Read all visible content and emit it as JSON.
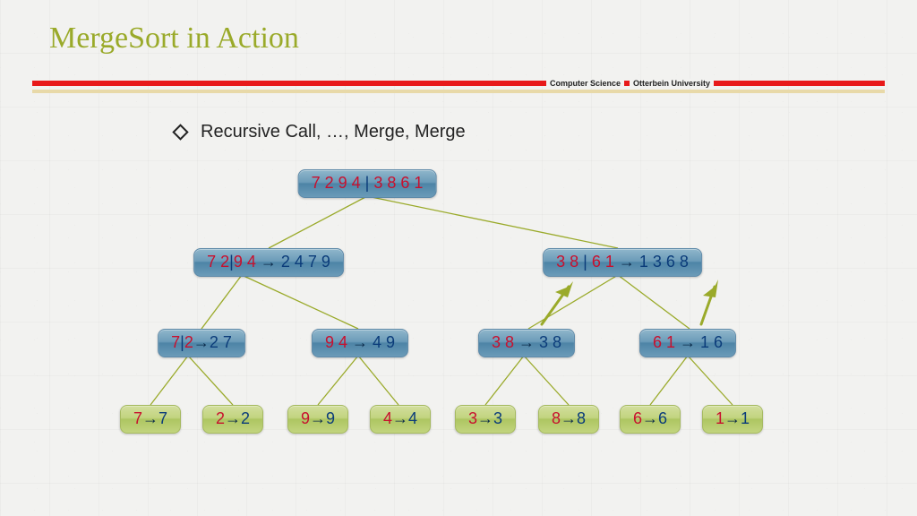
{
  "title": "MergeSort in Action",
  "footer": {
    "dept": "Computer Science",
    "uni": "Otterbein University"
  },
  "bullet": "Recursive Call, …, Merge, Merge",
  "nodes": {
    "root": {
      "left": "7 2 9 4",
      "sep": " | ",
      "right": "3 8 6 1"
    },
    "l2a": {
      "in_l": "7 2",
      "sep1": "|",
      "in_r": "9 4",
      "arrow": " → ",
      "out": "2 4 7 9"
    },
    "l2b": {
      "in_l": "3 8",
      "sep1": " | ",
      "in_r": "6 1",
      "arrow": " → ",
      "out": "1 3 6 8"
    },
    "l3a": {
      "in_l": "7",
      "sep1": "|",
      "in_r": "2",
      "arrow": "→",
      "out": "2 7"
    },
    "l3b": {
      "in": "9 4",
      "arrow": " → ",
      "out": "4 9"
    },
    "l3c": {
      "in": "3 8",
      "arrow": " → ",
      "out": "3 8"
    },
    "l3d": {
      "in": "6 1",
      "arrow": " → ",
      "out": "1 6"
    },
    "leaf": [
      {
        "in": "7",
        "out": "7"
      },
      {
        "in": "2",
        "out": "2"
      },
      {
        "in": "9",
        "out": "9"
      },
      {
        "in": "4",
        "out": "4"
      },
      {
        "in": "3",
        "out": "3"
      },
      {
        "in": "8",
        "out": "8"
      },
      {
        "in": "6",
        "out": "6"
      },
      {
        "in": "1",
        "out": "1"
      }
    ]
  },
  "arrow_glyph": "→"
}
